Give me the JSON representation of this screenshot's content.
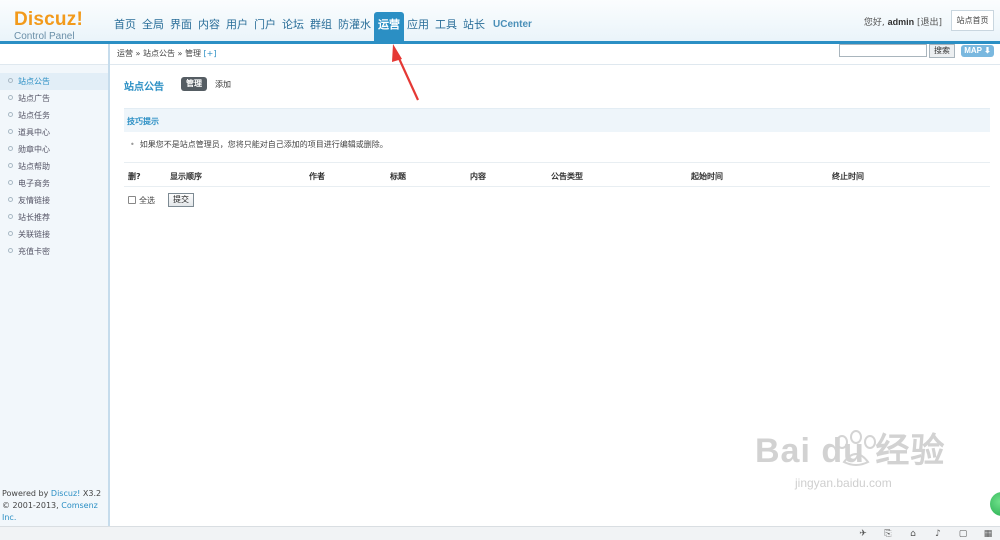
{
  "logo": {
    "name": "Discuz!",
    "subtitle": "Control Panel"
  },
  "nav": {
    "items": [
      "首页",
      "全局",
      "界面",
      "内容",
      "用户",
      "门户",
      "论坛",
      "群组",
      "防灌水",
      "运营",
      "应用",
      "工具",
      "站长",
      "UCenter"
    ],
    "active": "运营"
  },
  "user": {
    "greeting": "您好,",
    "name": "admin",
    "logout": "[退出]",
    "site_home": "站点首页"
  },
  "breadcrumb": {
    "path": "运营 » 站点公告 » 管理",
    "add": "[+]"
  },
  "search": {
    "value": "",
    "button": "搜索",
    "map_button": "MAP ⬇"
  },
  "sidebar": {
    "items": [
      "站点公告",
      "站点广告",
      "站点任务",
      "道具中心",
      "勋章中心",
      "站点帮助",
      "电子商务",
      "友情链接",
      "站长推荐",
      "关联链接",
      "充值卡密"
    ],
    "active_index": 0,
    "powered_prefix": "Powered by ",
    "powered_brand": "Discuz!",
    "powered_version": " X3.2",
    "copyright_prefix": "© 2001-2013, ",
    "copyright_company": "Comsenz Inc."
  },
  "main": {
    "title": "站点公告",
    "tab_manage": "管理",
    "tab_add": "添加",
    "tips_title": "技巧提示",
    "tip": "如果您不是站点管理员，您将只能对自己添加的项目进行编辑或删除。",
    "columns": [
      "删?",
      "显示顺序",
      "作者",
      "标题",
      "内容",
      "公告类型",
      "起始时间",
      "终止时间"
    ],
    "select_all": "全选",
    "submit": "提交"
  },
  "watermark": {
    "main": "Bai du 经验",
    "sub": "jingyan.baidu.com"
  },
  "colors": {
    "accent": "#2b8fc4",
    "logo": "#f29a1b",
    "arrow": "#e53935"
  }
}
